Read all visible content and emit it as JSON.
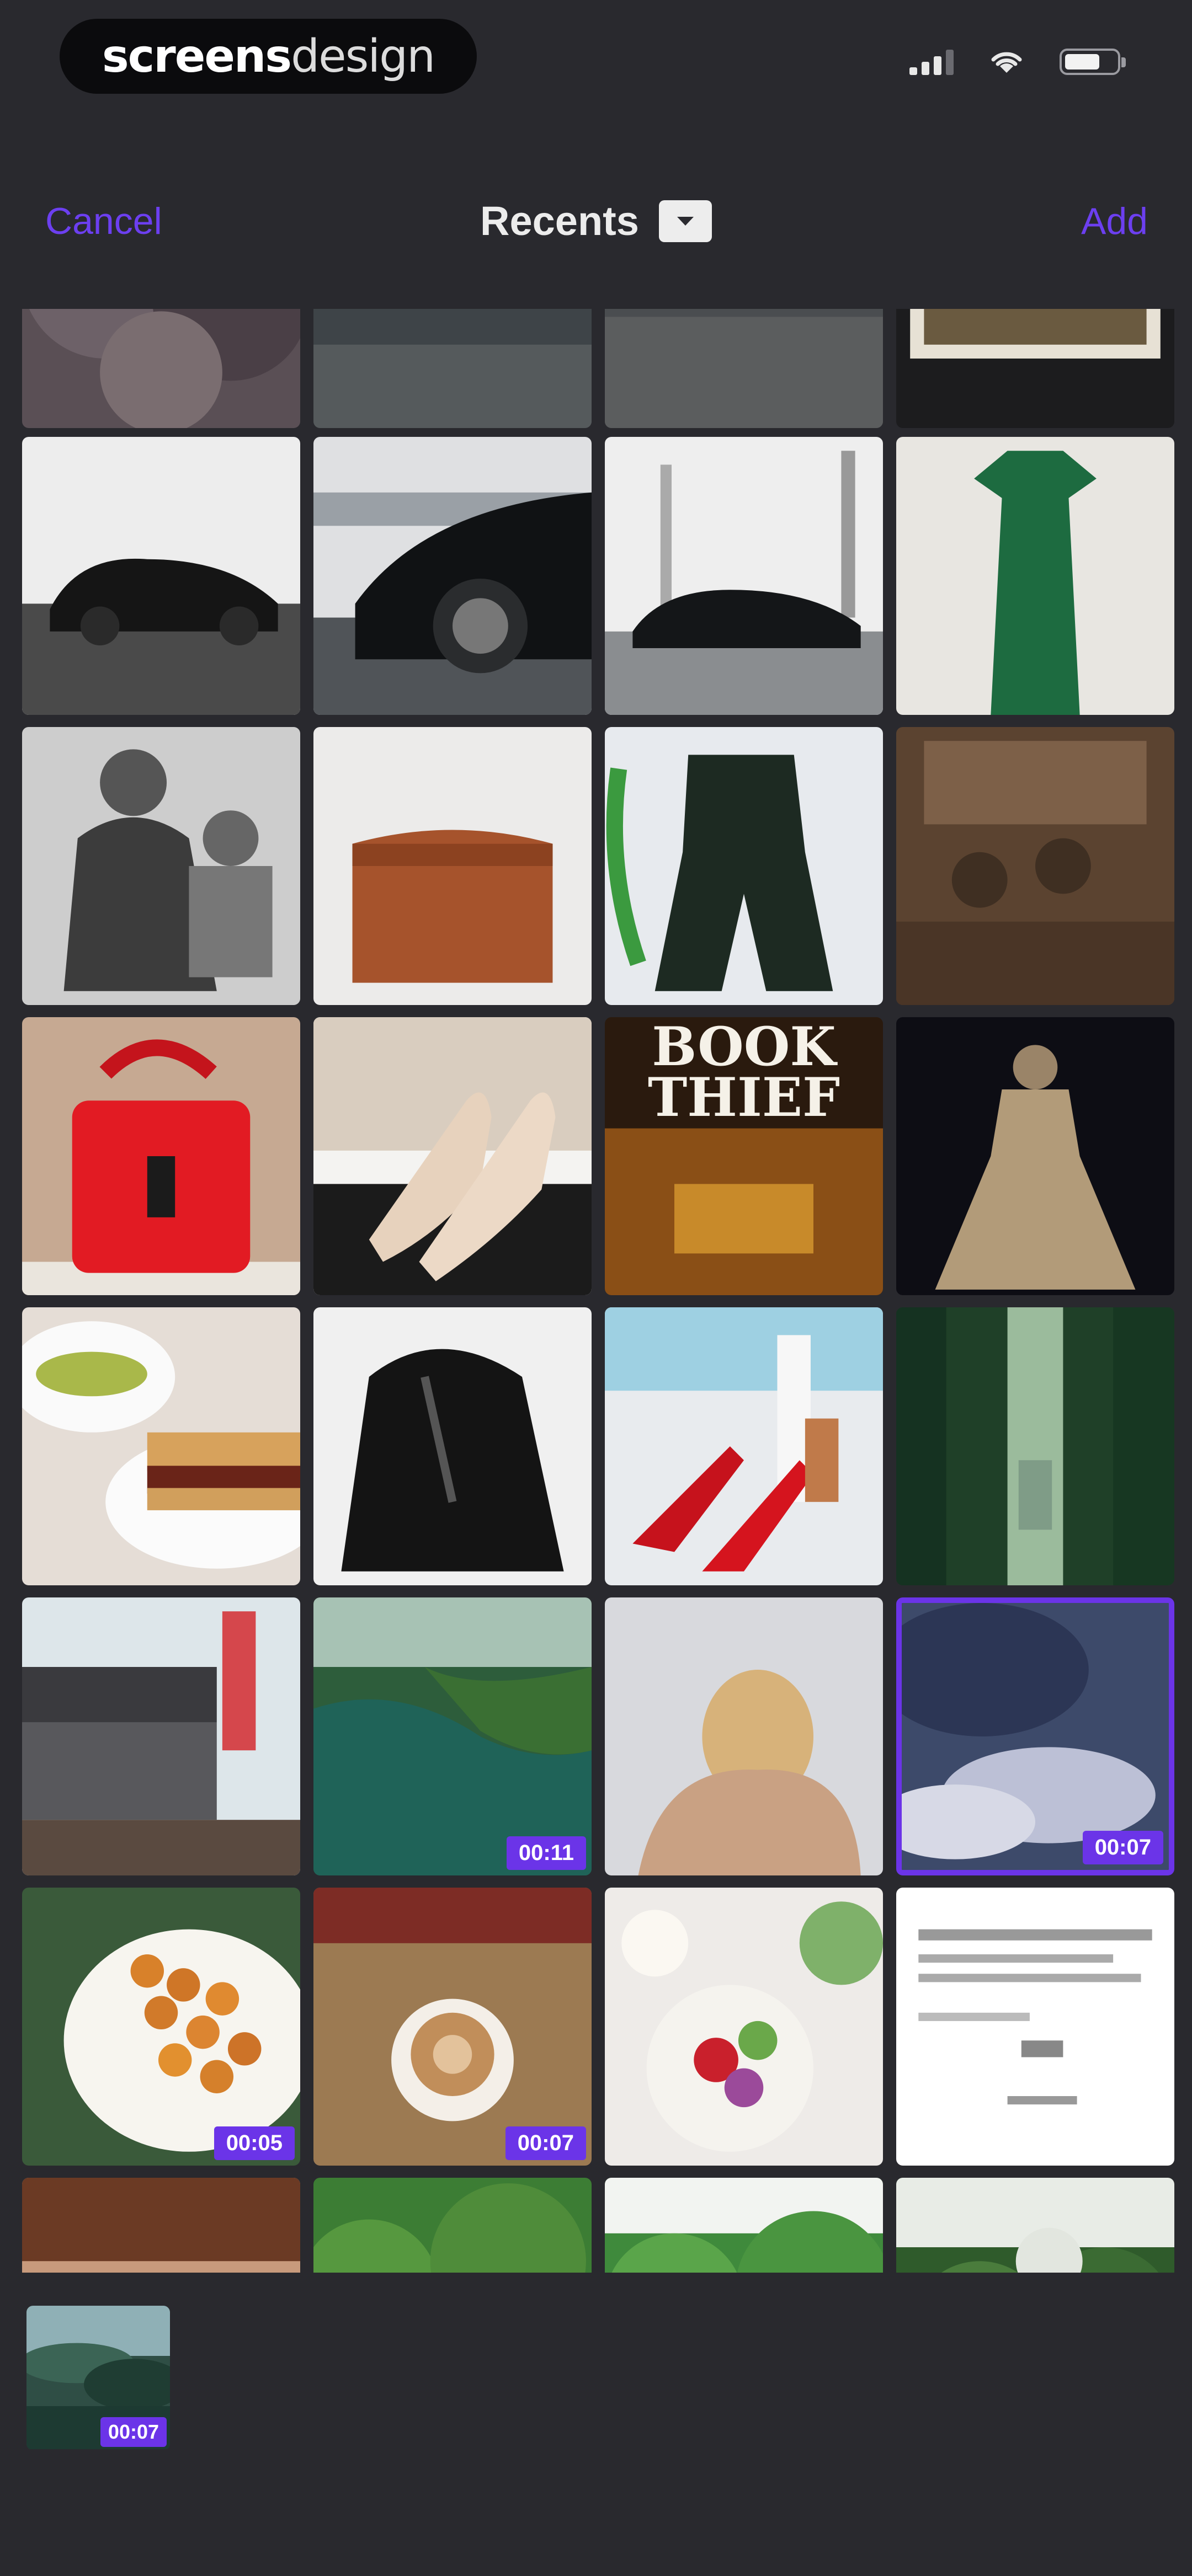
{
  "status_bar": {
    "brand_bold": "screens",
    "brand_light": "design",
    "signal_icon": "signal-icon",
    "wifi_icon": "wifi-icon",
    "battery_icon": "battery-icon",
    "battery_level": 0.7
  },
  "nav": {
    "cancel_label": "Cancel",
    "title": "Recents",
    "album_toggle_icon": "chevron-down-box-icon",
    "add_label": "Add",
    "accent_color": "#6c3ff0"
  },
  "grid": {
    "columns": 4,
    "items": [
      {
        "desc": "rocks",
        "duration": ""
      },
      {
        "desc": "black car rear",
        "duration": ""
      },
      {
        "desc": "cars on road",
        "duration": ""
      },
      {
        "desc": "framed photo",
        "duration": ""
      },
      {
        "desc": "black sports car",
        "duration": ""
      },
      {
        "desc": "black porsche close",
        "duration": ""
      },
      {
        "desc": "car by building",
        "duration": ""
      },
      {
        "desc": "green dress",
        "duration": ""
      },
      {
        "desc": "vintage portrait",
        "duration": ""
      },
      {
        "desc": "brown leather bag",
        "duration": ""
      },
      {
        "desc": "green romper",
        "duration": ""
      },
      {
        "desc": "sepia group",
        "duration": ""
      },
      {
        "desc": "red handbag",
        "duration": ""
      },
      {
        "desc": "white heels",
        "duration": ""
      },
      {
        "desc": "book thief cover",
        "duration": "",
        "text_lines": [
          "BOOK",
          "THIEF"
        ]
      },
      {
        "desc": "lace gown",
        "duration": ""
      },
      {
        "desc": "sandwich plate",
        "duration": ""
      },
      {
        "desc": "black leather jacket",
        "duration": ""
      },
      {
        "desc": "red sandals",
        "duration": ""
      },
      {
        "desc": "forest",
        "duration": ""
      },
      {
        "desc": "city street",
        "duration": ""
      },
      {
        "desc": "river valley",
        "duration": "00:11"
      },
      {
        "desc": "woman back",
        "duration": ""
      },
      {
        "desc": "clouds mountains",
        "duration": "00:07",
        "selected": true
      },
      {
        "desc": "fried snacks",
        "duration": "00:05"
      },
      {
        "desc": "latte",
        "duration": "00:07"
      },
      {
        "desc": "salad bowl",
        "duration": ""
      },
      {
        "desc": "document page",
        "duration": ""
      },
      {
        "desc": "face close up",
        "duration": ""
      },
      {
        "desc": "green trees",
        "duration": ""
      },
      {
        "desc": "green hills",
        "duration": ""
      },
      {
        "desc": "leafy plants",
        "duration": ""
      }
    ]
  },
  "bottom_item": {
    "desc": "forest aerial",
    "duration": "00:07"
  }
}
